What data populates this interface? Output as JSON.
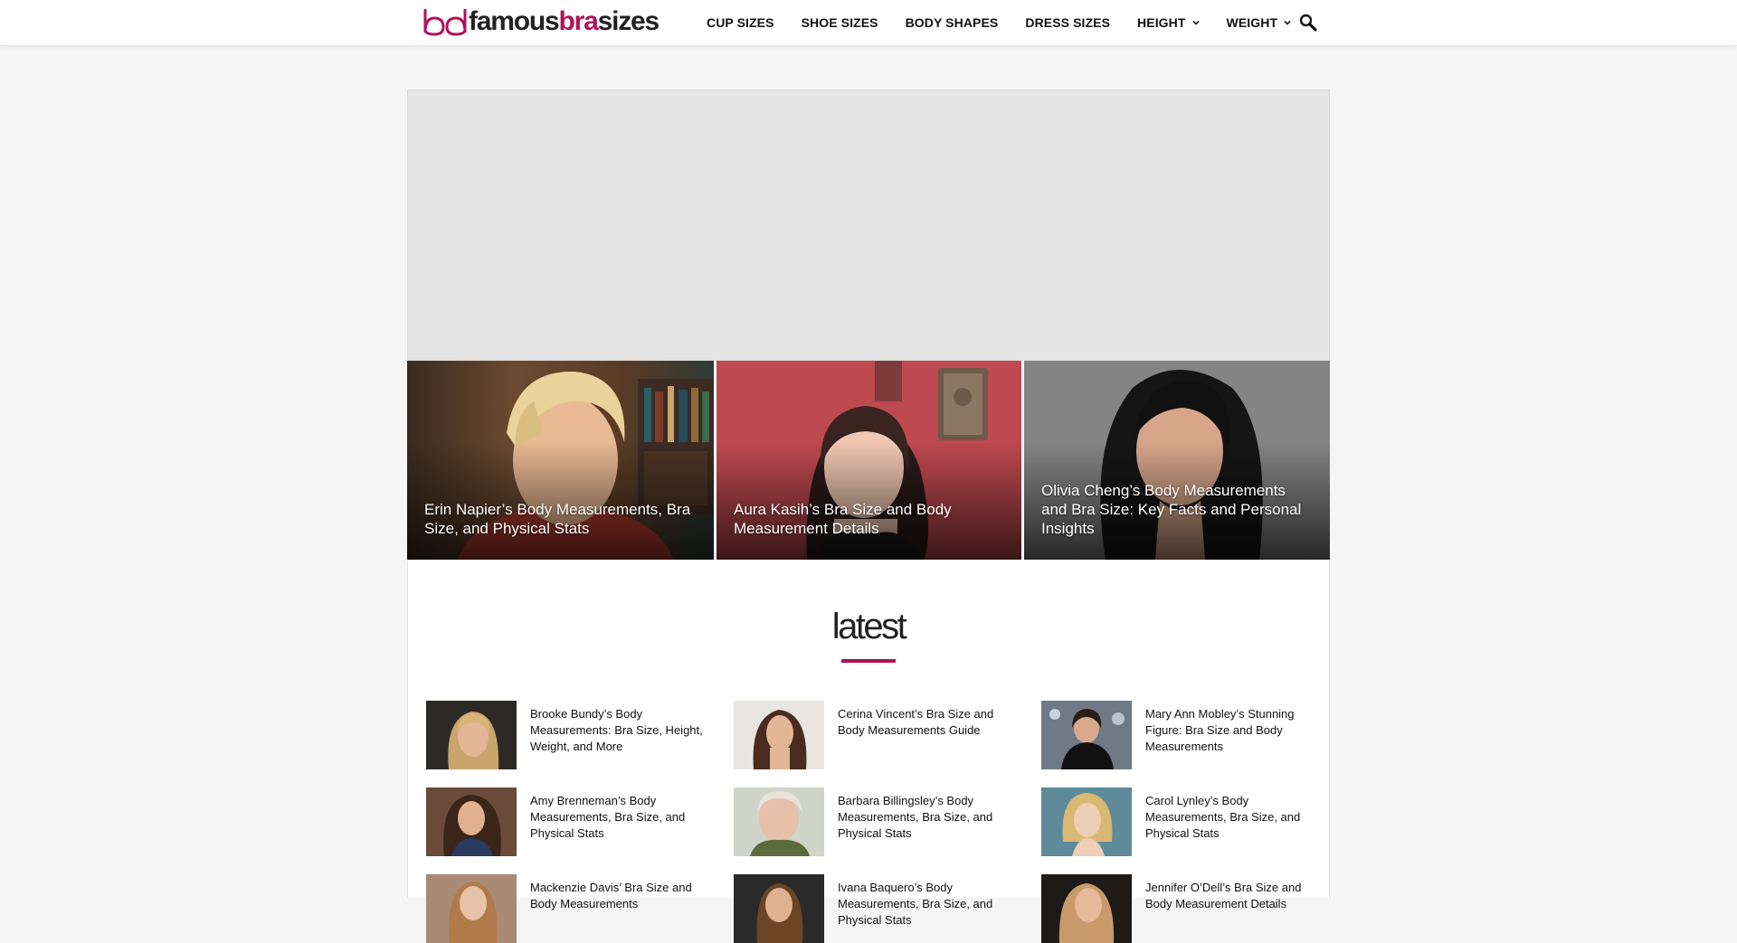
{
  "site": {
    "logo_part1": "famous",
    "logo_part2": "bra",
    "logo_part3": "sizes",
    "brand_color": "#b0125b"
  },
  "nav": {
    "items": [
      {
        "label": "CUP SIZES",
        "has_dropdown": false
      },
      {
        "label": "SHOE SIZES",
        "has_dropdown": false
      },
      {
        "label": "BODY SHAPES",
        "has_dropdown": false
      },
      {
        "label": "DRESS SIZES",
        "has_dropdown": false
      },
      {
        "label": "HEIGHT",
        "has_dropdown": true
      },
      {
        "label": "WEIGHT",
        "has_dropdown": true
      }
    ],
    "search_icon": "search-icon"
  },
  "featured": [
    {
      "title": "Erin Napier’s Body Measurements, Bra Size, and Physical Stats"
    },
    {
      "title": "Aura Kasih’s Bra Size and Body Measurement Details"
    },
    {
      "title": "Olivia Cheng’s Body Measurements and Bra Size: Key Facts and Personal Insights"
    }
  ],
  "latest": {
    "heading": "latest",
    "posts": [
      {
        "title": "Brooke Bundy’s Body Measurements: Bra Size, Height, Weight, and More"
      },
      {
        "title": "Cerina Vincent’s Bra Size and Body Measurements Guide"
      },
      {
        "title": "Mary Ann Mobley’s Stunning Figure: Bra Size and Body Measurements"
      },
      {
        "title": "Amy Brenneman’s Body Measurements, Bra Size, and Physical Stats"
      },
      {
        "title": "Barbara Billingsley’s Body Measurements, Bra Size, and Physical Stats"
      },
      {
        "title": "Carol Lynley’s Body Measurements, Bra Size, and Physical Stats"
      },
      {
        "title": "Mackenzie Davis’ Bra Size and Body Measurements"
      },
      {
        "title": "Ivana Baquero’s Body Measurements, Bra Size, and Physical Stats"
      },
      {
        "title": "Jennifer O’Dell’s Bra Size and Body Measurement Details"
      }
    ]
  }
}
